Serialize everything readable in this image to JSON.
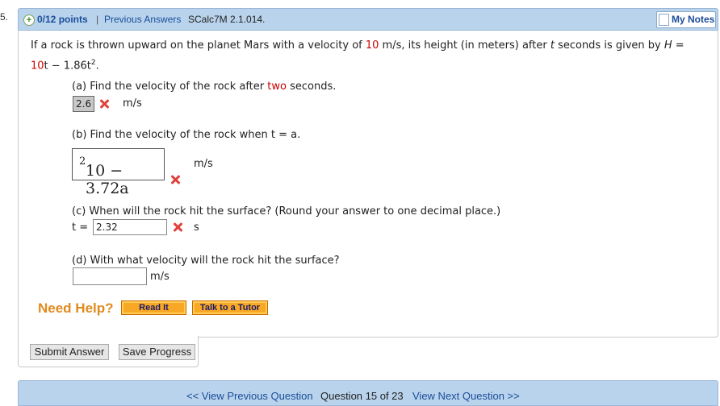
{
  "question_number_fragment": "5.",
  "header": {
    "points": "0/12 points",
    "separator": "|",
    "previous_answers": "Previous Answers",
    "question_id": "SCalc7M 2.1.014.",
    "my_notes": "My Notes"
  },
  "problem": {
    "intro_part1": "If a rock is thrown upward on the planet Mars with a velocity of ",
    "intro_velocity": "10",
    "intro_part2": " m/s, its height (in meters) after ",
    "intro_t": "t",
    "intro_part3": " seconds is given by ",
    "intro_H": "H",
    "intro_eq": " =",
    "formula_10": "10",
    "formula_rest": "t − 1.86t",
    "formula_exp": "2",
    "formula_end": "."
  },
  "part_a": {
    "question_pre": "(a) Find the velocity of the rock after ",
    "question_red": "two",
    "question_post": " seconds.",
    "answer": "2.6",
    "unit": "m/s"
  },
  "part_b": {
    "question": "(b) Find the velocity of the rock when t = a.",
    "answer_main": "10 − 3.72a",
    "answer_exp": "2",
    "unit": "m/s"
  },
  "part_c": {
    "question": "(c) When will the rock hit the surface? (Round your answer to one decimal place.)",
    "prefix": "t =",
    "answer": "2.32",
    "unit": "s"
  },
  "part_d": {
    "question": "(d) With what velocity will the rock hit the surface?",
    "answer": "",
    "unit": "m/s"
  },
  "help": {
    "label": "Need Help?",
    "read_it": "Read It",
    "talk_to_tutor": "Talk to a Tutor"
  },
  "actions": {
    "submit": "Submit Answer",
    "save": "Save Progress"
  },
  "footer": {
    "prev": "<< View Previous Question",
    "count": "Question 15 of 23",
    "next": "View Next Question >>"
  },
  "colors": {
    "header_bg": "#b9d3ec",
    "link": "#1a4d9a",
    "error_x": "#e0403a",
    "accent_red": "#cc0000",
    "help_orange": "#e08a1e"
  }
}
